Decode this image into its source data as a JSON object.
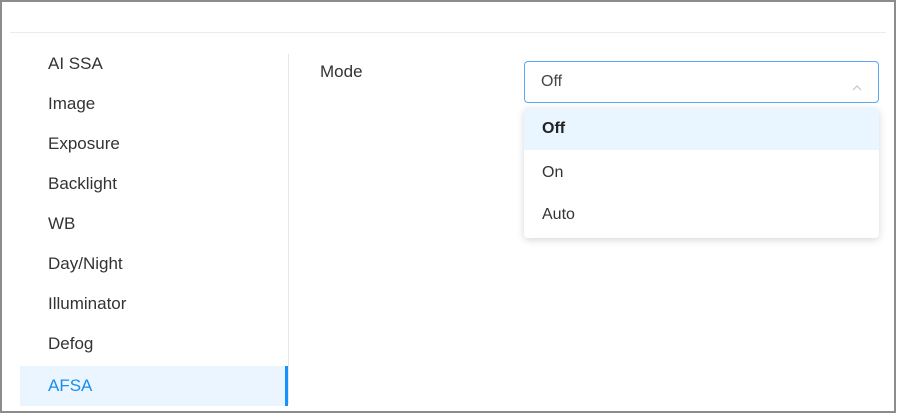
{
  "sidebar": {
    "items": [
      {
        "label": "AI SSA",
        "active": false
      },
      {
        "label": "Image",
        "active": false
      },
      {
        "label": "Exposure",
        "active": false
      },
      {
        "label": "Backlight",
        "active": false
      },
      {
        "label": "WB",
        "active": false
      },
      {
        "label": "Day/Night",
        "active": false
      },
      {
        "label": "Illuminator",
        "active": false
      },
      {
        "label": "Defog",
        "active": false
      },
      {
        "label": "AFSA",
        "active": true
      }
    ]
  },
  "form": {
    "mode_label": "Mode",
    "mode_select": {
      "value": "Off",
      "options": [
        {
          "label": "Off",
          "selected": true
        },
        {
          "label": "On",
          "selected": false
        },
        {
          "label": "Auto",
          "selected": false
        }
      ]
    }
  },
  "colors": {
    "accent": "#1890ff",
    "active_bg": "#eaf5ff",
    "selected_option_bg": "#e9f5ff",
    "select_border": "#5aa8f5"
  },
  "icons": {
    "select_caret": "chevron-up-icon"
  }
}
